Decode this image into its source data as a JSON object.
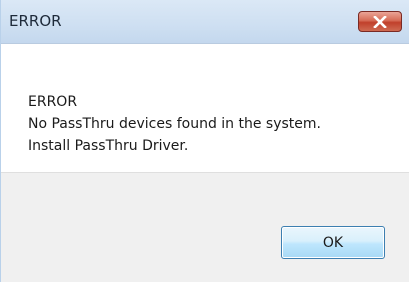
{
  "window": {
    "title": "ERROR"
  },
  "message": {
    "heading": "ERROR",
    "line1": "No PassThru devices found in the system.",
    "line2": "Install PassThru Driver."
  },
  "buttons": {
    "ok_label": "OK"
  },
  "icons": {
    "close": "close-icon"
  },
  "colors": {
    "close_button": "#c7503a",
    "ok_button_border": "#3c7fb1",
    "footer_background": "#f0f0f0"
  }
}
